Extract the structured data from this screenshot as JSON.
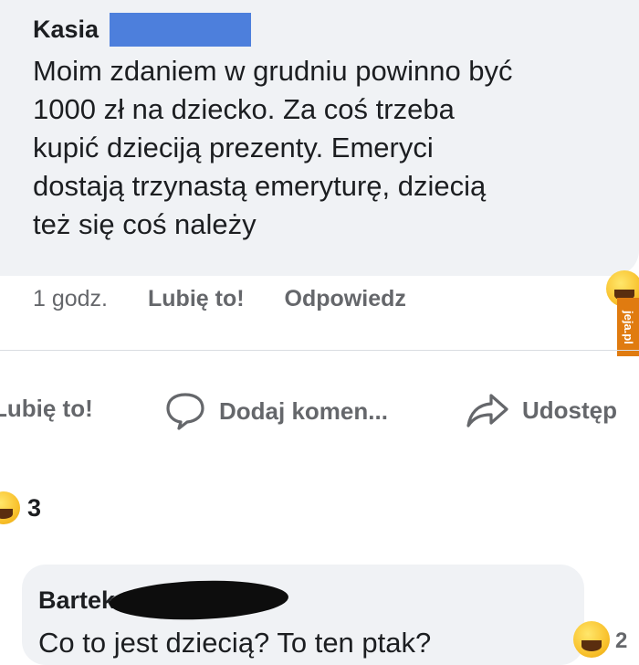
{
  "comment": {
    "author": "Kasia",
    "text": "Moim zdaniem w grudniu powinno być\n1000 zł na dziecko. Za coś trzeba\nkupić dzieciją prezenty. Emeryci\ndostają trzynastą emeryturę, dziecią\nteż się coś należy",
    "time": "1 godz.",
    "like_label": "Lubię to!",
    "reply_label": "Odpowiedz",
    "reaction_icon": "laughing-emoji"
  },
  "watermark": "jeja.pl",
  "post_actions": {
    "like": "Lubię to!",
    "comment": "Dodaj komen...",
    "share": "Udostęp"
  },
  "post_reactions": {
    "icon": "laughing-emoji",
    "count": "3"
  },
  "reply": {
    "author": "Bartek",
    "text": "Co to jest dziecią? To ten ptak?",
    "reaction_icon": "laughing-emoji",
    "reaction_count": "2"
  },
  "colors": {
    "bubble_bg": "#f0f2f5",
    "meta_text": "#65676b",
    "redaction_blue": "#4d7fdc",
    "redaction_black": "#0d0d0d",
    "watermark_bg": "#e07b10"
  }
}
